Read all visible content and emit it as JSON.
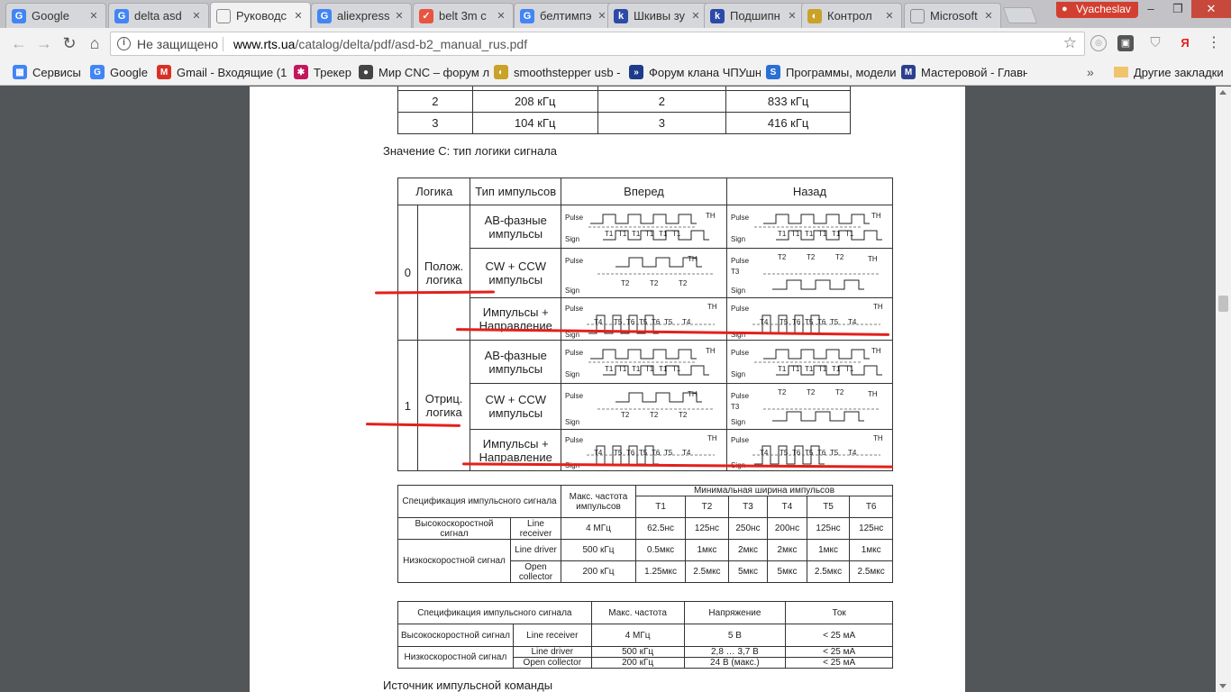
{
  "browser": {
    "tabs": [
      {
        "title": "Google",
        "icon": "google-icon",
        "color": "#4285f4",
        "glyph": "G"
      },
      {
        "title": "delta asd",
        "icon": "google-icon",
        "color": "#4285f4",
        "glyph": "G"
      },
      {
        "title": "Руководс",
        "icon": "document-icon",
        "color": "#8a8a8a",
        "glyph": "",
        "active": true
      },
      {
        "title": "aliexpress",
        "icon": "google-icon",
        "color": "#4285f4",
        "glyph": "G"
      },
      {
        "title": "belt 3m с",
        "icon": "pocket-icon",
        "color": "#e8543f",
        "glyph": "✓"
      },
      {
        "title": "белтимпэ",
        "icon": "google-icon",
        "color": "#4285f4",
        "glyph": "G"
      },
      {
        "title": "Шкивы зу",
        "icon": "site-icon",
        "color": "#2c4aa8",
        "glyph": "k"
      },
      {
        "title": "Подшипн",
        "icon": "site-icon",
        "color": "#2c4aa8",
        "glyph": "k"
      },
      {
        "title": "Контрол",
        "icon": "tool-icon",
        "color": "#c9a227",
        "glyph": "◐"
      },
      {
        "title": "Microsoft",
        "icon": "document-icon",
        "color": "#8a8a8a",
        "glyph": ""
      }
    ],
    "profile_name": "Vyacheslav",
    "window_controls": {
      "minimize": "–",
      "maximize": "❐",
      "close": "✕"
    },
    "security_label": "Не защищено",
    "url_domain": "www.rts.ua",
    "url_path": "/catalog/delta/pdf/asd-b2_manual_rus.pdf",
    "bookmarks": [
      {
        "label": "Сервисы",
        "icon": "apps-icon",
        "color": "#4285f4",
        "glyph": "▦"
      },
      {
        "label": "Google",
        "icon": "google-icon",
        "color": "#4285f4",
        "glyph": "G"
      },
      {
        "label": "Gmail - Входящие (1",
        "icon": "gmail-icon",
        "color": "#d93025",
        "glyph": "M"
      },
      {
        "label": "Трекер",
        "icon": "tracker-icon",
        "color": "#c2185b",
        "glyph": "✱"
      },
      {
        "label": "Мир CNC – форум л",
        "icon": "cnc-icon",
        "color": "#444444",
        "glyph": "●"
      },
      {
        "label": "smoothstepper usb -",
        "icon": "smooth-icon",
        "color": "#c9a227",
        "glyph": "◐"
      },
      {
        "label": "Форум клана ЧПУшн",
        "icon": "forum-icon",
        "color": "#1e3a8a",
        "glyph": "»"
      },
      {
        "label": "Программы, модели",
        "icon": "prog-icon",
        "color": "#2a6fd6",
        "glyph": "S"
      },
      {
        "label": "Мастеровой - Главн",
        "icon": "master-icon",
        "color": "#2c3f8f",
        "glyph": "M"
      }
    ],
    "bookmarks_more": "»",
    "other_bookmarks": "Другие закладки"
  },
  "document": {
    "freq_table": [
      [
        "2",
        "208 кГц",
        "2",
        "833 кГц"
      ],
      [
        "3",
        "104 кГц",
        "3",
        "416 кГц"
      ]
    ],
    "caption_logic": "Значение С: тип логики сигнала",
    "logic_table": {
      "headers": [
        "Логика",
        "Тип импульсов",
        "Вперед",
        "Назад"
      ],
      "groups": [
        {
          "value": "0",
          "name": "Полож. логика",
          "rows": [
            "АВ-фазные импульсы",
            "CW + CCW импульсы",
            "Импульсы + Направление"
          ]
        },
        {
          "value": "1",
          "name": "Отриц. логика",
          "rows": [
            "АВ-фазные импульсы",
            "CW + CCW импульсы",
            "Импульсы + Направление"
          ]
        }
      ],
      "wave_labels": {
        "pulse": "Pulse",
        "sign": "Sign",
        "th": "TH",
        "t1": "T1",
        "t2": "T2",
        "t3": "T3",
        "t4": "T4",
        "t5": "T5",
        "t6": "T6"
      }
    },
    "spec_table_1": {
      "h_spec": "Спецификация импульсного сигнала",
      "h_max": "Макс. частота импульсов",
      "h_min": "Минимальная ширина импульсов",
      "t_cols": [
        "T1",
        "T2",
        "T3",
        "T4",
        "T5",
        "T6"
      ],
      "high_speed": "Высокоскоростной сигнал",
      "low_speed": "Низкоскоростной сигнал",
      "rows": [
        {
          "type": "Line receiver",
          "freq": "4 МГц",
          "vals": [
            "62.5нс",
            "125нс",
            "250нс",
            "200нс",
            "125нс",
            "125нс"
          ]
        },
        {
          "type": "Line driver",
          "freq": "500 кГц",
          "vals": [
            "0.5мкс",
            "1мкс",
            "2мкс",
            "2мкс",
            "1мкс",
            "1мкс"
          ]
        },
        {
          "type": "Open collector",
          "freq": "200 кГц",
          "vals": [
            "1.25мкс",
            "2.5мкс",
            "5мкс",
            "5мкс",
            "2.5мкс",
            "2.5мкс"
          ]
        }
      ]
    },
    "spec_table_2": {
      "headers": [
        "Спецификация импульсного сигнала",
        "Макс. частота",
        "Напряжение",
        "Ток"
      ],
      "high_speed": "Высокоскоростной сигнал",
      "low_speed": "Низкоскоростной сигнал",
      "rows": [
        {
          "type": "Line receiver",
          "freq": "4 МГц",
          "volt": "5 В",
          "current": "< 25 мА"
        },
        {
          "type": "Line driver",
          "freq": "500 кГц",
          "volt": "2,8 … 3,7 В",
          "current": "< 25 мА"
        },
        {
          "type": "Open collector",
          "freq": "200 кГц",
          "volt": "24 В (макс.)",
          "current": "< 25 мА"
        }
      ]
    },
    "caption_bottom": "Источник импульсной команды",
    "annotation_color": "#e3201b"
  }
}
